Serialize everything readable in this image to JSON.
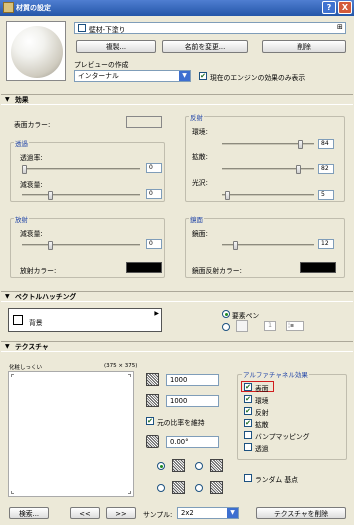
{
  "window": {
    "title": "材質の設定",
    "help": "?",
    "close": "X"
  },
  "header": {
    "material_name": "壁材-下塗り",
    "copy_button": "複製...",
    "rename_button": "名前を変更...",
    "delete_button": "削除",
    "preview_label": "プレビューの作成",
    "preview_select": "インターナル",
    "engine_only_label": "現在のエンジンの効果のみ表示",
    "engine_only_checked": true
  },
  "effects": {
    "section_title": "効果",
    "surface_color_label": "表面カラー:",
    "transparency": {
      "title": "透過",
      "opacity_label": "透過率:",
      "opacity_value": "0",
      "attenuation_label": "減衰量:",
      "attenuation_value": "0"
    },
    "reflection": {
      "title": "反射",
      "ambient_label": "環境:",
      "ambient_value": "84",
      "diffuse_label": "拡散:",
      "diffuse_value": "82",
      "shine_label": "光沢:",
      "shine_value": "5"
    },
    "emission": {
      "title": "放射",
      "attenuation_label": "減衰量:",
      "attenuation_value": "0",
      "color_label": "放射カラー:"
    },
    "specular": {
      "title": "鏡面",
      "specular_label": "鏡面:",
      "specular_value": "12",
      "color_label": "鏡面反射カラー:"
    }
  },
  "vector_hatching": {
    "section_title": "ベクトルハッチング",
    "pattern_name": "背景",
    "pen_label": "要素ペン",
    "pen_number": "1"
  },
  "texture": {
    "section_title": "テクスチャ",
    "preview_label": "化粧しっくい",
    "preview_size": "(375 × 375)",
    "width_value": "1000",
    "height_value": "1000",
    "keep_ratio_label": "元の比率を維持",
    "keep_ratio_checked": true,
    "angle_value": "0.00°",
    "alpha_title": "アルファチャネル効果",
    "alpha_items": [
      {
        "label": "表面",
        "checked": true
      },
      {
        "label": "環境",
        "checked": true
      },
      {
        "label": "反射",
        "checked": true
      },
      {
        "label": "拡散",
        "checked": true
      },
      {
        "label": "バンプマッピング",
        "checked": false
      },
      {
        "label": "透過",
        "checked": false
      }
    ],
    "random_origin_label": "ランダム 基点",
    "random_origin_checked": false
  },
  "footer": {
    "search_button": "検索...",
    "prev_button": "<<",
    "next_button": ">>",
    "sample_label": "サンプル:",
    "sample_value": "2x2",
    "remove_texture_button": "テクスチャを削除"
  },
  "colors": {
    "title_bar": "#2456a8",
    "group_title": "#2145a8",
    "highlight_box": "#d11e1e"
  }
}
